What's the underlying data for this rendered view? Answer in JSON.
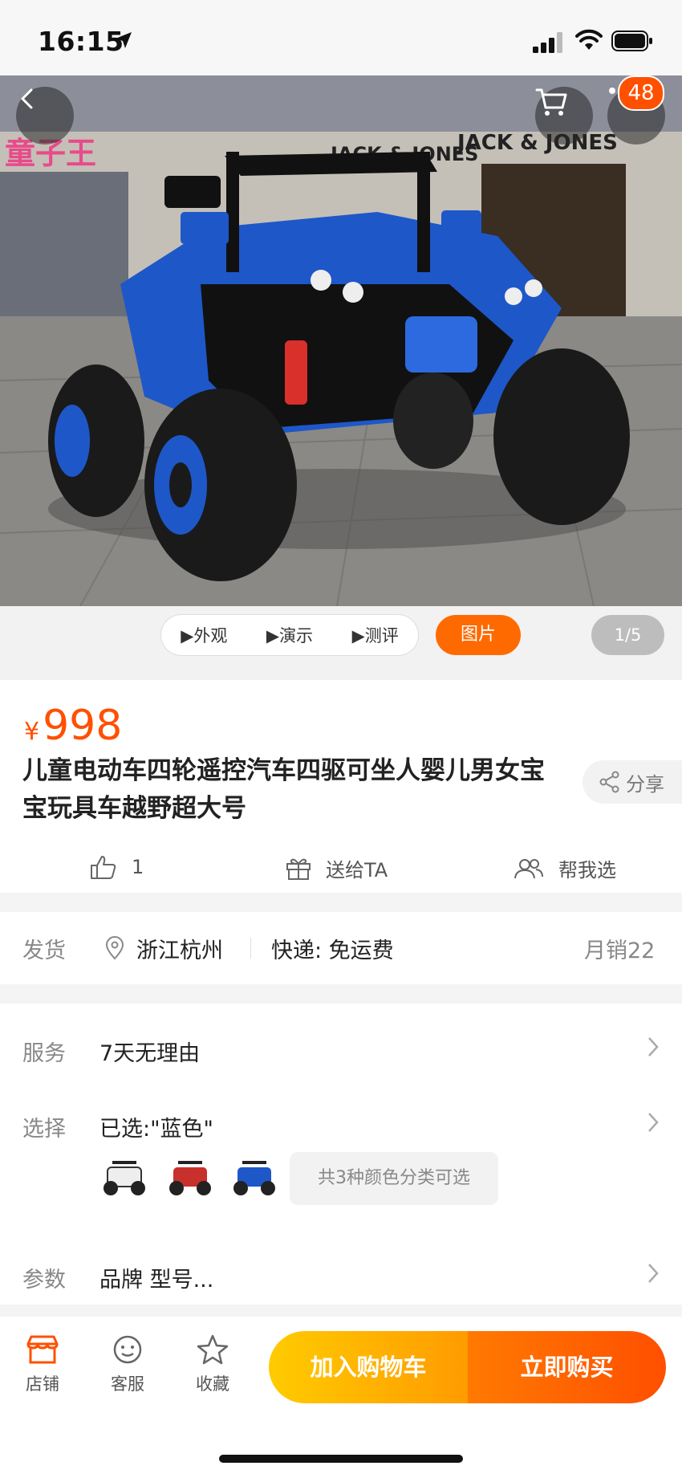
{
  "status": {
    "time": "16:15"
  },
  "header": {
    "cart_badge": "48"
  },
  "media": {
    "tabs": [
      "▶外观",
      "▶演示",
      "▶测评"
    ],
    "image_tab": "图片",
    "page_indicator": "1/5",
    "storefront_texts": [
      "JACK & JONES",
      "JACK & JONES"
    ]
  },
  "product": {
    "currency": "¥",
    "price": "998",
    "title": "儿童电动车四轮遥控汽车四驱可坐人婴儿男女宝宝玩具车越野超大号",
    "share_label": "分享",
    "likes": "1",
    "gift_label": "送给TA",
    "help_label": "帮我选"
  },
  "shipping": {
    "label": "发货",
    "location": "浙江杭州",
    "delivery": "快递: 免运费",
    "monthly_sales": "月销22"
  },
  "details": {
    "service_label": "服务",
    "service_value": "7天无理由",
    "select_label": "选择",
    "select_value": "已选:\"蓝色\"",
    "color_count": "共3种颜色分类可选",
    "params_label": "参数",
    "params_value": "品牌 型号..."
  },
  "bottom": {
    "store": "店铺",
    "service": "客服",
    "favorite": "收藏",
    "add_to_cart": "加入购物车",
    "buy_now": "立即购买"
  },
  "colors": {
    "accent": "#ff5000",
    "blue_car": "#1e57c8",
    "red_car": "#c8302c"
  }
}
